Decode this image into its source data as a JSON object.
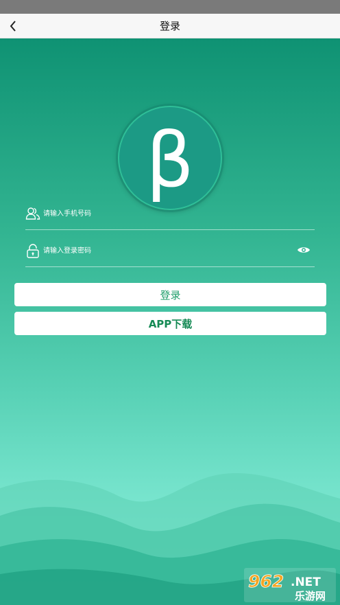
{
  "header": {
    "title": "登录"
  },
  "logo": {
    "glyph": "β"
  },
  "form": {
    "phone_placeholder": "请输入手机号码",
    "password_placeholder": "请输入登录密码"
  },
  "buttons": {
    "login_label": "登录",
    "download_label": "APP下载"
  },
  "watermark": {
    "line1": "962.NET",
    "line2": "乐游网"
  },
  "icons": {
    "back": "chevron-left-icon",
    "user": "users-icon",
    "lock": "lock-icon",
    "eye": "eye-icon"
  },
  "colors": {
    "primary_dark": "#0f9273",
    "primary_light": "#8aeedb",
    "button_text": "#1e9e6a"
  }
}
